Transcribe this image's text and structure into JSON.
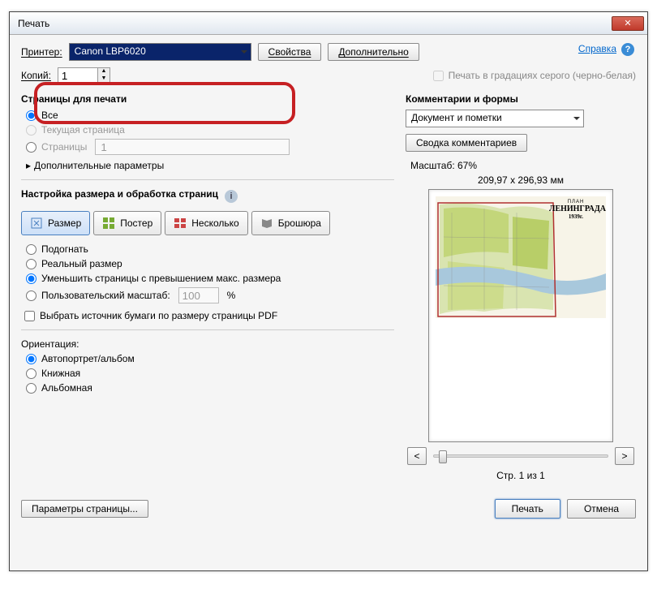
{
  "window": {
    "title": "Печать"
  },
  "top": {
    "printer_label": "Принтер:",
    "printer_value": "Canon LBP6020",
    "properties_btn": "Свойства",
    "advanced_btn": "Дополнительно",
    "help_link": "Справка",
    "copies_label": "Копий:",
    "copies_value": "1",
    "grayscale_label": "Печать в градациях серого (черно-белая)"
  },
  "pages": {
    "title": "Страницы для печати",
    "all": "Все",
    "current": "Текущая страница",
    "pages_label": "Страницы",
    "pages_value": "1",
    "more": "Дополнительные параметры"
  },
  "size": {
    "title": "Настройка размера и обработка страниц",
    "tab_size": "Размер",
    "tab_poster": "Постер",
    "tab_multiple": "Несколько",
    "tab_booklet": "Брошюра",
    "fit": "Подогнать",
    "actual": "Реальный размер",
    "shrink": "Уменьшить страницы с превышением макс. размера",
    "custom": "Пользовательский масштаб:",
    "custom_value": "100",
    "percent": "%",
    "choose_source": "Выбрать источник бумаги по размеру страницы PDF"
  },
  "orient": {
    "title": "Ориентация:",
    "auto": "Автопортрет/альбом",
    "portrait": "Книжная",
    "landscape": "Альбомная"
  },
  "comments": {
    "title": "Комментарии и формы",
    "select_value": "Документ и пометки",
    "summary_btn": "Сводка комментариев"
  },
  "preview": {
    "scale_label": "Масштаб:  67%",
    "dims": "209,97 x 296,93 мм",
    "map_small": "ПЛАН",
    "map_big": "ЛЕНИНГРАДА",
    "map_year": "1939г.",
    "page_info": "Стр. 1 из 1",
    "prev": "<",
    "next": ">"
  },
  "bottom": {
    "page_setup": "Параметры страницы...",
    "print": "Печать",
    "cancel": "Отмена"
  }
}
